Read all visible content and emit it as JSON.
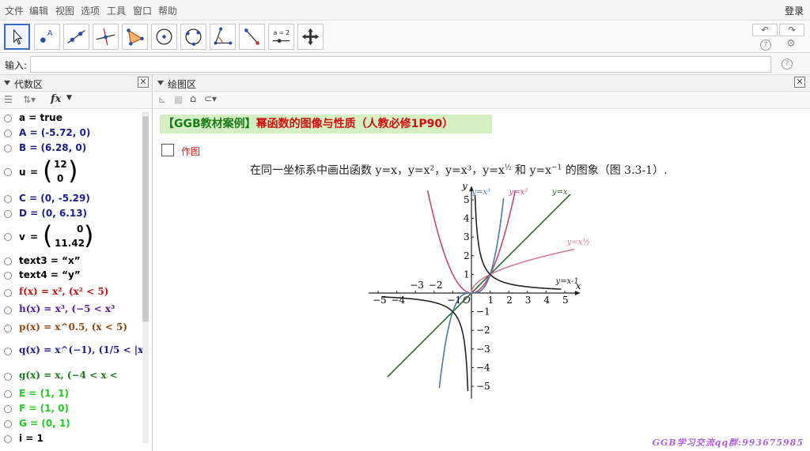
{
  "menu": [
    "文件",
    "编辑",
    "视图",
    "选项",
    "工具",
    "窗口",
    "帮助"
  ],
  "login_label": "登录",
  "toolbar": {
    "tools": [
      "move-tool",
      "point-tool",
      "line-tool",
      "perpendicular-tool",
      "polygon-tool",
      "circle-tool",
      "conic-tool",
      "angle-tool",
      "reflect-tool",
      "slider-tool",
      "move-view-tool"
    ],
    "undo_label": "↶",
    "redo_label": "↷",
    "slider_tool_text": "a = 2"
  },
  "input": {
    "label": "输入:",
    "value": ""
  },
  "algebra": {
    "title": "代数区",
    "fx_label": "fx",
    "items": [
      {
        "text": "a = true",
        "color": "#000000"
      },
      {
        "text": "A = (-5.72, 0)",
        "color": "#1c1c8c"
      },
      {
        "text": "B = (6.28, 0)",
        "color": "#1c1c8c"
      },
      {
        "text": "u = (12, 0)",
        "name": "u",
        "top": "12",
        "bottom": "0",
        "color": "#000000"
      },
      {
        "text": "C = (0, -5.29)",
        "color": "#1c1c8c"
      },
      {
        "text": "D = (0, 6.13)",
        "color": "#1c1c8c"
      },
      {
        "text": "v = (0, 11.42)",
        "name": "v",
        "top": "0",
        "bottom": "11.42",
        "color": "#000000"
      },
      {
        "text": "text3 = “x”",
        "color": "#000000"
      },
      {
        "text": "text4 = “y”",
        "color": "#000000"
      },
      {
        "text": "f(x) = x², (x² < 5)",
        "color": "#b81515"
      },
      {
        "text": "h(x) = x³, (−5 < x³",
        "color": "#5a1a9c"
      },
      {
        "text": "p(x) = x^0.5, (x < 5)",
        "color": "#8a4a10"
      },
      {
        "text": "q(x) = x^(−1), (1/5 < |x",
        "color": "#1c1c8c"
      },
      {
        "text": "g(x) = x, (−4 < x <",
        "color": "#1b7a1b"
      },
      {
        "text": "E = (1, 1)",
        "color": "#22cc22"
      },
      {
        "text": "F = (1, 0)",
        "color": "#22cc22"
      },
      {
        "text": "G = (0, 1)",
        "color": "#22cc22"
      },
      {
        "text": "i = 1",
        "color": "#000000"
      }
    ]
  },
  "graphics": {
    "title": "绘图区",
    "banner_bracket_open": "【",
    "banner_green": "GGB教材案例",
    "banner_bracket_close": "】",
    "banner_red": "幂函数的图像与性质（人教必修1P90）",
    "draw_label": "作图",
    "problem_prefix": "在同一坐标系中画出函数 y=x，y=x²，y=x³，y=x",
    "problem_exp": "½",
    "problem_mid": " 和 y=x",
    "problem_exp2": "−1",
    "problem_suffix": " 的图象（图 3.3-1）.",
    "footer": "GGB学习交流qq群:993675985"
  },
  "chart_data": {
    "type": "line",
    "title": "",
    "xlabel": "x",
    "ylabel": "y",
    "xlim": [
      -5.5,
      5.5
    ],
    "ylim": [
      -5.5,
      5.5
    ],
    "x_ticks": [
      -5,
      -4,
      -3,
      -2,
      -1,
      1,
      2,
      3,
      4,
      5
    ],
    "y_ticks": [
      -5,
      -4,
      -3,
      -2,
      -1,
      1,
      2,
      3,
      4,
      5
    ],
    "origin_label": "O",
    "series": [
      {
        "name": "y=x",
        "color": "#2d6b2d",
        "domain": [
          -4.5,
          5.3
        ],
        "fn": "x"
      },
      {
        "name": "y=x²",
        "color": "#c24a7a",
        "domain": [
          -2.35,
          2.35
        ],
        "fn": "x2"
      },
      {
        "name": "y=x³",
        "color": "#4a7aa6",
        "domain": [
          -1.72,
          1.72
        ],
        "fn": "x3"
      },
      {
        "name": "y=x½",
        "color": "#d27a9a",
        "domain": [
          0,
          5.5
        ],
        "fn": "sqrt"
      },
      {
        "name": "y=x-1",
        "color": "#222222",
        "domain": [
          -4.8,
          4.8
        ],
        "fn": "inv"
      }
    ],
    "grid": false,
    "legend": "inline-labels"
  }
}
